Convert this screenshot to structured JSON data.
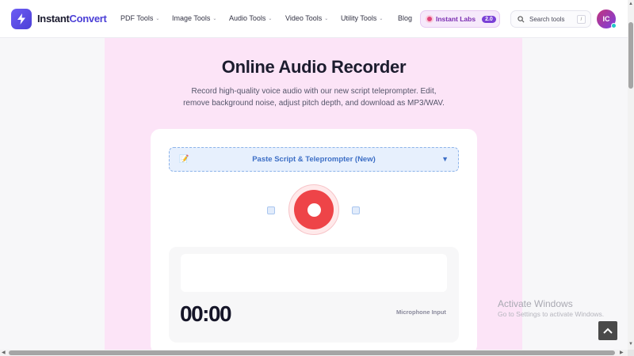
{
  "header": {
    "brand_prefix": "Instant",
    "brand_suffix": "Convert",
    "nav": [
      {
        "label": "PDF Tools",
        "has_menu": true
      },
      {
        "label": "Image Tools",
        "has_menu": true
      },
      {
        "label": "Audio Tools",
        "has_menu": true
      },
      {
        "label": "Video Tools",
        "has_menu": true
      },
      {
        "label": "Utility Tools",
        "has_menu": true
      },
      {
        "label": "Blog",
        "has_menu": false
      }
    ],
    "labs_label": "Instant Labs",
    "labs_badge": "2.0",
    "search_placeholder": "Search tools",
    "search_shortcut": "/",
    "avatar_initials": "IC"
  },
  "main": {
    "title": "Online Audio Recorder",
    "subtitle_line1": "Record high-quality voice audio with our new script teleprompter. Edit,",
    "subtitle_line2": "remove background noise, adjust pitch depth, and download as MP3/WAV.",
    "dropdown_label": "Paste Script & Teleprompter (New)",
    "timer": "00:00",
    "mic_label": "Microphone Input"
  },
  "watermark": {
    "line1": "Activate Windows",
    "line2": "Go to Settings to activate Windows."
  },
  "colors": {
    "brand": "#4b3fd6",
    "panel_bg": "#fce4f7",
    "record": "#ee4448",
    "dropdown_text": "#3d6fc6"
  },
  "icons": {
    "logo": "lightning-icon",
    "dropdown": "notepad-icon",
    "search": "search-icon",
    "back_to_top": "chevron-up-icon"
  }
}
